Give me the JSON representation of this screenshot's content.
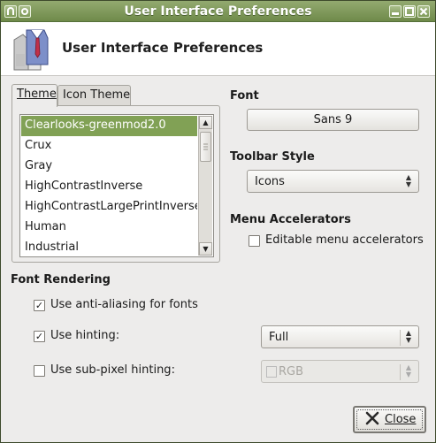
{
  "window": {
    "title": "User Interface Preferences",
    "controls": {
      "menu": "∩",
      "close_small": "▣",
      "minimize": "▬",
      "maximize": "▢",
      "close": "✕"
    }
  },
  "header": {
    "title": "User Interface Preferences",
    "icon": "shirt-tie-icon"
  },
  "tabs": [
    {
      "label": "Theme",
      "active": true
    },
    {
      "label": "Icon Theme",
      "active": false
    }
  ],
  "theme_list": {
    "items": [
      {
        "label": "Clearlooks-greenmod2.0",
        "selected": true
      },
      {
        "label": "Crux",
        "selected": false
      },
      {
        "label": "Gray",
        "selected": false
      },
      {
        "label": "HighContrastInverse",
        "selected": false
      },
      {
        "label": "HighContrastLargePrintInverse",
        "selected": false
      },
      {
        "label": "Human",
        "selected": false
      },
      {
        "label": "Industrial",
        "selected": false
      }
    ],
    "scroll_up": "▲",
    "scroll_down": "▼"
  },
  "font": {
    "heading": "Font",
    "value": "Sans 9"
  },
  "toolbar_style": {
    "heading": "Toolbar Style",
    "value": "Icons"
  },
  "menu_accelerators": {
    "heading": "Menu Accelerators",
    "editable_label": "Editable menu accelerators",
    "editable_checked": false
  },
  "font_rendering": {
    "heading": "Font Rendering",
    "antialias_label": "Use anti-aliasing for fonts",
    "antialias_checked": true,
    "hinting_label": "Use hinting:",
    "hinting_checked": true,
    "hinting_value": "Full",
    "subpixel_label": "Use sub-pixel hinting:",
    "subpixel_checked": false,
    "subpixel_value": "RGB"
  },
  "close_button": {
    "label": "Close"
  },
  "colors": {
    "accent": "#81a155",
    "titlebar": "#7e9a58"
  }
}
